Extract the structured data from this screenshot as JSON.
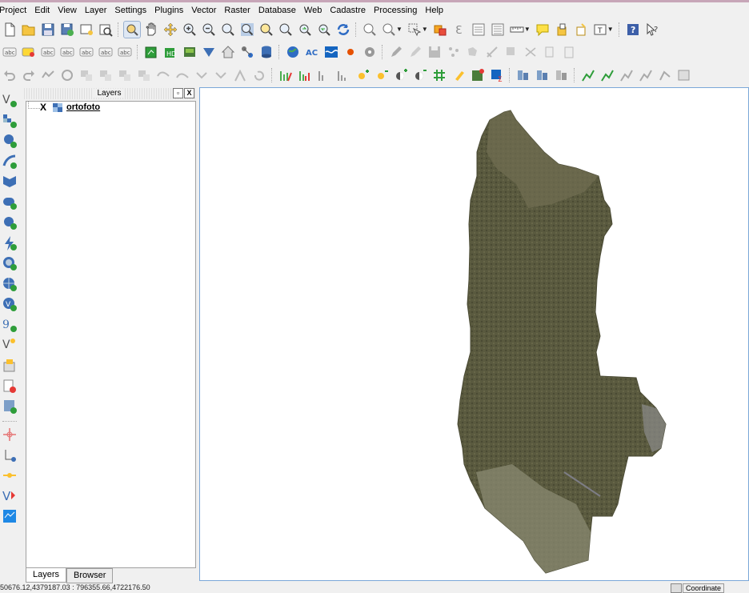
{
  "menu": [
    {
      "label": "Project",
      "name": "menu-project"
    },
    {
      "label": "Edit",
      "name": "menu-edit"
    },
    {
      "label": "View",
      "name": "menu-view"
    },
    {
      "label": "Layer",
      "name": "menu-layer"
    },
    {
      "label": "Settings",
      "name": "menu-settings"
    },
    {
      "label": "Plugins",
      "name": "menu-plugins"
    },
    {
      "label": "Vector",
      "name": "menu-vector"
    },
    {
      "label": "Raster",
      "name": "menu-raster"
    },
    {
      "label": "Database",
      "name": "menu-database"
    },
    {
      "label": "Web",
      "name": "menu-web"
    },
    {
      "label": "Cadastre",
      "name": "menu-cadastre"
    },
    {
      "label": "Processing",
      "name": "menu-processing"
    },
    {
      "label": "Help",
      "name": "menu-help"
    }
  ],
  "toolbar_labels": {
    "label_tool_text": "abc",
    "ac_text": "AC",
    "help_text": "?"
  },
  "layers_panel": {
    "title": "Layers",
    "layers": [
      {
        "name": "ortofoto",
        "visible_mark": "X"
      }
    ],
    "tabs": [
      "Layers",
      "Browser"
    ],
    "float_btn": "▫",
    "close_btn": "X"
  },
  "status": {
    "coordinates": "50676.12,4379187.03 : 796355.66,4722176.50",
    "coord_label": "Coordinate"
  },
  "colors": {
    "accent": "#7aa7d8",
    "map_background": "#ffffff",
    "raster_main": "#5b5b3f",
    "raster_light": "#7c7a5f",
    "raster_coast": "#8a8a72"
  },
  "icons": {
    "toolbar1": [
      "new-project-icon",
      "open-project-icon",
      "save-project-icon",
      "save-as-icon",
      "new-print-composer-icon",
      "composer-manager-icon",
      "pan-map-icon",
      "pan-icon",
      "pan-to-selection-icon",
      "zoom-in-icon",
      "zoom-out-icon",
      "zoom-native-icon",
      "zoom-full-icon",
      "zoom-to-selection-icon",
      "zoom-to-layer-icon",
      "zoom-last-icon",
      "zoom-next-icon",
      "refresh-icon",
      "identify-icon",
      "select-icon",
      "deselect-icon",
      "field-calculator-icon",
      "attribute-table-icon",
      "statistics-icon",
      "measure-icon",
      "map-tips-icon",
      "new-bookmark-icon",
      "show-bookmarks-icon",
      "text-annotation-icon",
      "help-contents-icon",
      "whats-this-icon"
    ]
  }
}
